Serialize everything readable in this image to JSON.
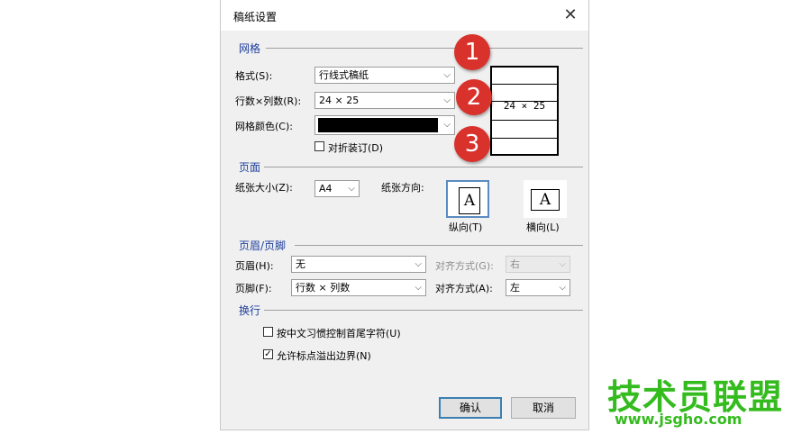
{
  "dialog": {
    "title": "稿纸设置",
    "close_glyph": "✕"
  },
  "grid": {
    "section": "网格",
    "style_label": "格式(S):",
    "style_value": "行线式稿纸",
    "rows_cols_label": "行数×列数(R):",
    "rows_cols_value": "24 × 25",
    "color_label": "网格颜色(C):",
    "color_value": "#000000",
    "fold_label": "对折装订(D)",
    "fold_checked": false,
    "preview_text": "24 × 25"
  },
  "page": {
    "section": "页面",
    "size_label": "纸张大小(Z):",
    "size_value": "A4",
    "orientation_label": "纸张方向:",
    "portrait_label": "纵向(T)",
    "landscape_label": "横向(L)",
    "page_glyph": "A",
    "portrait_selected": true
  },
  "header_footer": {
    "section": "页眉/页脚",
    "header_label": "页眉(H):",
    "header_value": "无",
    "header_align_label": "对齐方式(G):",
    "header_align_value": "右",
    "footer_label": "页脚(F):",
    "footer_value": "行数 × 列数",
    "footer_align_label": "对齐方式(A):",
    "footer_align_value": "左"
  },
  "wrap": {
    "section": "换行",
    "option1_label": "按中文习惯控制首尾字符(U)",
    "option1_checked": false,
    "option2_label": "允许标点溢出边界(N)",
    "option2_checked": true
  },
  "buttons": {
    "ok": "确认",
    "cancel": "取消"
  },
  "markers": [
    "1",
    "2",
    "3"
  ],
  "watermark": {
    "text": "技术员联盟",
    "url": "www.jsgho.com"
  },
  "colors": {
    "accent": "#1f3f9c",
    "marker": "#d9312b",
    "watermark": "#34bb1e"
  }
}
